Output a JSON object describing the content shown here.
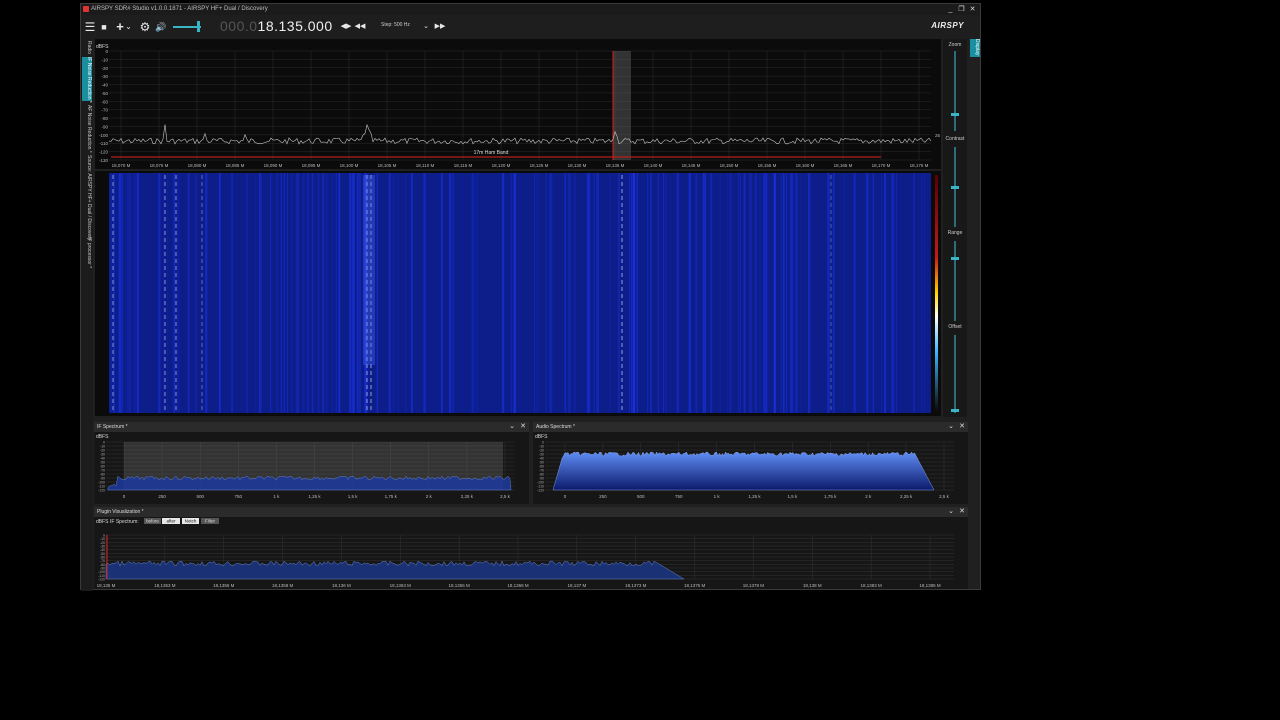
{
  "window": {
    "title": "AIRSPY SDR# Studio v1.0.0.1871 - AIRSPY HF+ Dual / Discovery",
    "controls": {
      "minimize": "_",
      "maximize": "❐",
      "close": "✕"
    }
  },
  "toolbar": {
    "menu_icon": "☰",
    "stop_icon": "■",
    "add_icon": "+",
    "add_dropdown_icon": "⌄",
    "settings_icon": "⚙",
    "volume_icon": "🔊",
    "frequency_dim": "000.0",
    "frequency_bright": "18.135.000",
    "tune_icons": [
      "◀▶",
      "◀◀"
    ],
    "step_label": "Step: 500 Hz",
    "step_dropdown_icon": "⌄",
    "forward_icon": "▶▶",
    "brand": "AIRSPY",
    "accent_color": "#3ab5c4"
  },
  "left_tabs": [
    {
      "label": "Radio",
      "active": false
    },
    {
      "label": "IF Noise Reduction *",
      "active": true
    },
    {
      "label": "AF Noise Reduction *",
      "active": false
    },
    {
      "label": "Source: AIRSPY HF+ Dual / Discovery",
      "active": false
    },
    {
      "label": "IF processor *",
      "active": false
    }
  ],
  "right_tabs": [
    {
      "label": "Display",
      "active": true
    }
  ],
  "spectrum": {
    "unit": "dBFS",
    "y_ticks": [
      "0",
      "-10",
      "-20",
      "-30",
      "-40",
      "-50",
      "-60",
      "-70",
      "-80",
      "-90",
      "-100",
      "-110",
      "-120",
      "-130"
    ],
    "x_ticks": [
      "18,070 M",
      "18,075 M",
      "18,080 M",
      "18,085 M",
      "18,090 M",
      "18,095 M",
      "18,100 M",
      "18,105 M",
      "18,110 M",
      "18,115 M",
      "18,120 M",
      "18,125 M",
      "18,130 M",
      "18,135 M",
      "18,140 M",
      "18,145 M",
      "18,150 M",
      "18,155 M",
      "18,160 M",
      "18,165 M",
      "18,170 M",
      "18,175 M"
    ],
    "band_label": "17m Ham Band",
    "right_value": "25",
    "color": "#c8c8c8"
  },
  "waterfall": {
    "background_color": "#0d1d8a"
  },
  "display_controls": {
    "zoom_label": "Zoom",
    "contrast_label": "Contrast",
    "range_label": "Range",
    "offset_label": "Offset"
  },
  "if_spectrum": {
    "title": "IF Spectrum *",
    "unit": "dBFS",
    "y_ticks": [
      "0",
      "-10",
      "-20",
      "-30",
      "-40",
      "-50",
      "-60",
      "-70",
      "-80",
      "-90",
      "-100",
      "-110",
      "-120"
    ],
    "x_ticks": [
      "0",
      "250",
      "500",
      "750",
      "1 k",
      "1,25 k",
      "1,5 k",
      "1,75 k",
      "2 k",
      "2,25 k",
      "2,5 k"
    ],
    "collapse_icon": "⌄",
    "close_icon": "✕"
  },
  "audio_spectrum": {
    "title": "Audio Spectrum *",
    "unit": "dBFS",
    "y_ticks": [
      "0",
      "-10",
      "-20",
      "-30",
      "-40",
      "-50",
      "-60",
      "-70",
      "-80",
      "-90",
      "-100",
      "-110",
      "-120"
    ],
    "x_ticks": [
      "0",
      "250",
      "500",
      "750",
      "1 k",
      "1,25 k",
      "1,5 k",
      "1,75 k",
      "2 k",
      "2,25 k",
      "2,5 k"
    ],
    "collapse_icon": "⌄",
    "close_icon": "✕"
  },
  "plugin_visualization": {
    "title": "Plugin Visualization *",
    "unit": "dBFS",
    "header_label": "IF Spectrum:",
    "buttons": [
      "before",
      "after",
      "Notch",
      "Filter"
    ],
    "y_ticks": [
      "0",
      "-10",
      "-20",
      "-30",
      "-40",
      "-50",
      "-60",
      "-70",
      "-80",
      "-90",
      "-100",
      "-110",
      "-120"
    ],
    "x_ticks": [
      "18,135 M",
      "18,1353 M",
      "18,1355 M",
      "18,1358 M",
      "18,136 M",
      "18,1363 M",
      "18,1365 M",
      "18,1368 M",
      "18,137 M",
      "18,1373 M",
      "18,1375 M",
      "18,1378 M",
      "18,138 M",
      "18,1383 M",
      "18,1385 M"
    ],
    "collapse_icon": "⌄",
    "close_icon": "✕"
  }
}
